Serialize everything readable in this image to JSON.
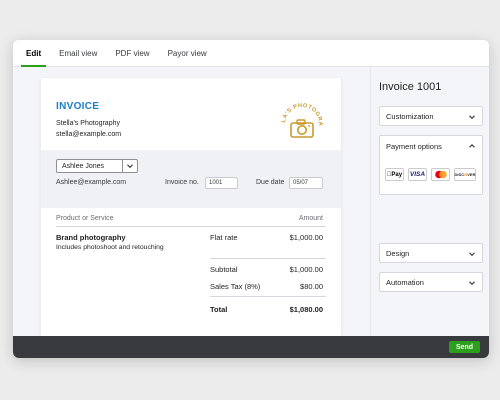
{
  "tabs": [
    {
      "label": "Edit",
      "active": true
    },
    {
      "label": "Email view",
      "active": false
    },
    {
      "label": "PDF view",
      "active": false
    },
    {
      "label": "Payor view",
      "active": false
    }
  ],
  "invoice": {
    "title": "INVOICE",
    "company_name": "Stella's Photography",
    "company_email": "stella@example.com",
    "logo_text": "STELLA'S PHOTOGRAPHY",
    "customer": "Ashlee Jones",
    "customer_email": "Ashlee@example.com",
    "invoice_no_label": "Invoice no.",
    "invoice_no": "1001",
    "due_date_label": "Due date",
    "due_date": "05/07",
    "col_product": "Product or Service",
    "col_amount": "Amount",
    "line_item": {
      "name": "Brand photography",
      "description": "Includes photoshoot and retouching",
      "rate_label": "Flat rate",
      "amount": "$1,000.00"
    },
    "subtotal_label": "Subtotal",
    "subtotal": "$1,000.00",
    "tax_label": "Sales Tax (8%)",
    "tax": "$80.00",
    "total_label": "Total",
    "total": "$1,080.00"
  },
  "panel": {
    "title": "Invoice 1001",
    "sections": [
      "Customization",
      "Payment options",
      "Design",
      "Automation"
    ],
    "payment_cards": [
      "Apple Pay",
      "VISA",
      "Mastercard",
      "DISCOVER"
    ]
  },
  "footer": {
    "send_label": "Send"
  },
  "colors": {
    "accent_green": "#2ca01c",
    "invoice_blue": "#1b7fc0",
    "logo_gold": "#c99a2e",
    "footer_dark": "#393a3d"
  },
  "icons": [
    "chevron-down-icon",
    "chevron-up-icon",
    "camera-icon"
  ]
}
